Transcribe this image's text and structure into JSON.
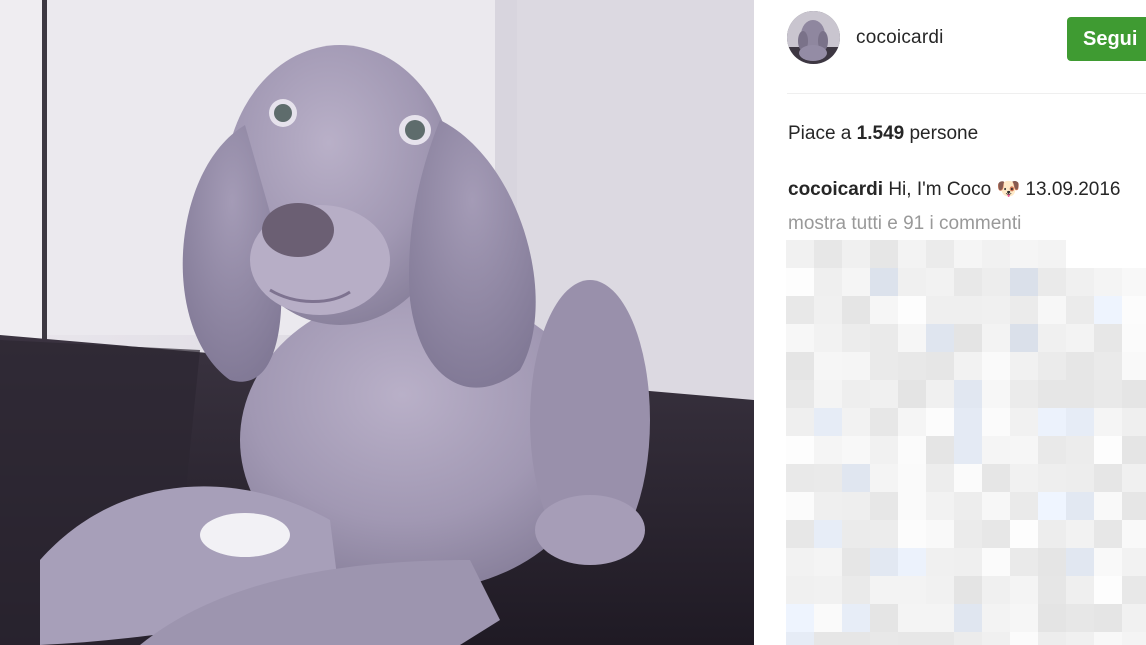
{
  "post": {
    "username": "cocoicardi",
    "follow_label": "Segui",
    "likes": {
      "prefix": "Piace a ",
      "count": "1.549",
      "suffix": " persone"
    },
    "caption": {
      "username": "cocoicardi",
      "text": " Hi, I'm Coco 🐶 13.09.2016"
    },
    "view_all_comments": "mostra tutti e 91 i commenti"
  },
  "colors": {
    "follow_button": "#3f9b32",
    "primary_text": "#262626",
    "secondary_text": "#999999"
  },
  "icons": {
    "caption_emoji": "dog-face-icon"
  }
}
